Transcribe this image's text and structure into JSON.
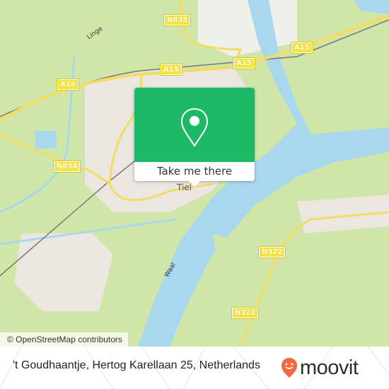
{
  "map": {
    "attribution": "© OpenStreetMap contributors",
    "road_shields": [
      {
        "label": "N835"
      },
      {
        "label": "A15"
      },
      {
        "label": "A15"
      },
      {
        "label": "A15"
      },
      {
        "label": "A15"
      },
      {
        "label": "N834"
      },
      {
        "label": "N322"
      },
      {
        "label": "N322"
      }
    ],
    "place_labels": [
      {
        "label": "Linge"
      },
      {
        "label": "Waal"
      },
      {
        "label": "Tiel"
      }
    ],
    "colors": {
      "land": "#cfe6a8",
      "urban": "#ece6e0",
      "water": "#a8d7ee",
      "road": "#f3dc63"
    }
  },
  "popup": {
    "icon": "map-pin-icon",
    "cta_label": "Take me there",
    "accent": "#1db966"
  },
  "footer": {
    "address": "'t Goudhaantje, Hertog Karellaan 25, Netherlands",
    "brand": "moovit",
    "brand_color": "#f26a3f"
  }
}
